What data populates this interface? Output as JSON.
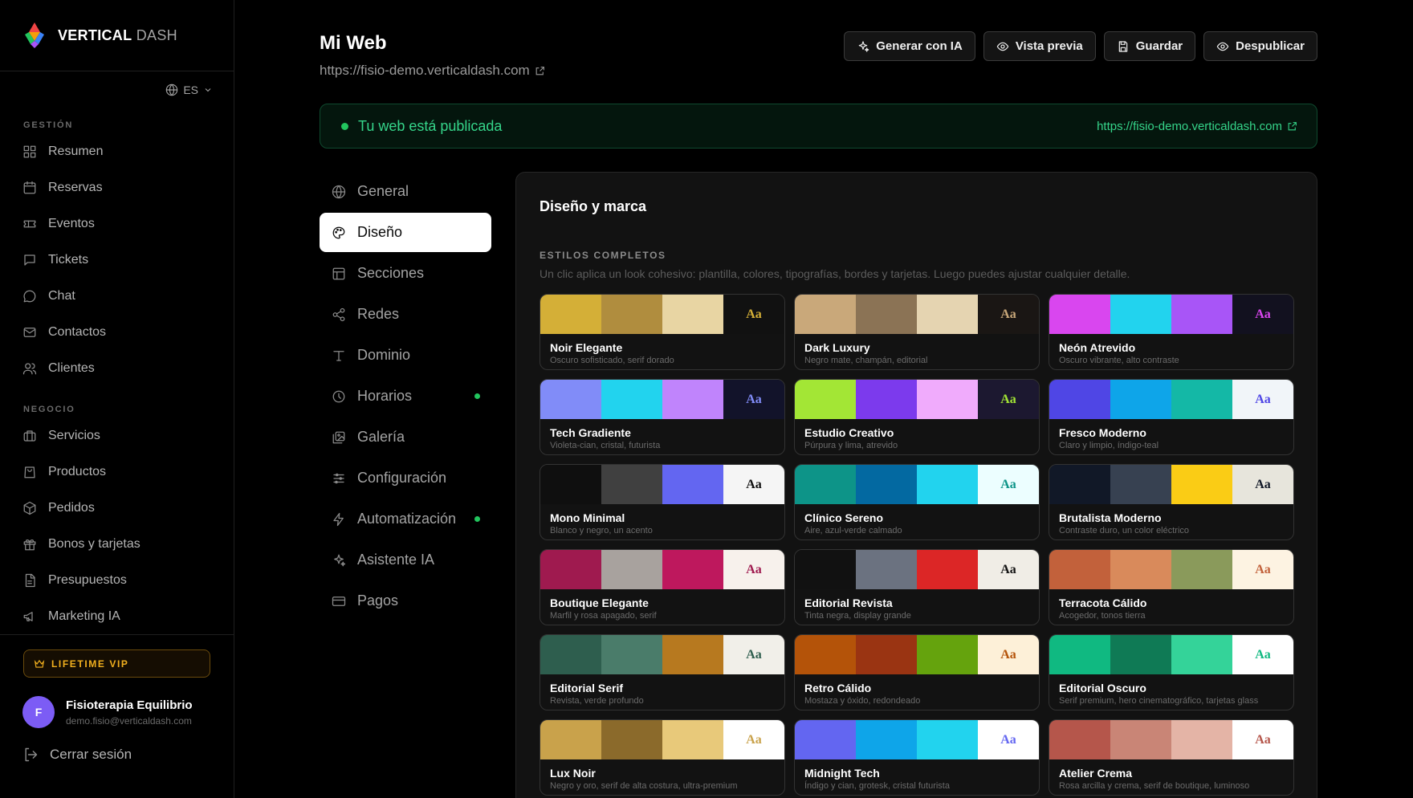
{
  "brand": {
    "name_bold": "VERTICAL",
    "name_light": "DASH"
  },
  "language": {
    "code": "ES"
  },
  "sidebar": {
    "sections": [
      {
        "label": "GESTIÓN",
        "items": [
          {
            "label": "Resumen",
            "icon": "grid-icon"
          },
          {
            "label": "Reservas",
            "icon": "calendar-icon"
          },
          {
            "label": "Eventos",
            "icon": "ticket-icon"
          },
          {
            "label": "Tickets",
            "icon": "message-square-icon"
          },
          {
            "label": "Chat",
            "icon": "chat-bubble-icon"
          },
          {
            "label": "Contactos",
            "icon": "mail-icon"
          },
          {
            "label": "Clientes",
            "icon": "users-icon"
          }
        ]
      },
      {
        "label": "NEGOCIO",
        "items": [
          {
            "label": "Servicios",
            "icon": "briefcase-icon"
          },
          {
            "label": "Productos",
            "icon": "shopping-bag-icon"
          },
          {
            "label": "Pedidos",
            "icon": "package-icon"
          },
          {
            "label": "Bonos y tarjetas",
            "icon": "gift-icon"
          },
          {
            "label": "Presupuestos",
            "icon": "file-text-icon"
          },
          {
            "label": "Marketing IA",
            "icon": "megaphone-icon"
          }
        ]
      }
    ],
    "vip_badge": "LIFETIME VIP",
    "user": {
      "initial": "F",
      "name": "Fisioterapia Equilibrio",
      "email": "demo.fisio@verticaldash.com"
    },
    "logout": "Cerrar sesión"
  },
  "header": {
    "title": "Mi Web",
    "url": "https://fisio-demo.verticaldash.com",
    "actions": [
      {
        "label": "Generar con IA",
        "icon": "sparkles-icon"
      },
      {
        "label": "Vista previa",
        "icon": "eye-icon"
      },
      {
        "label": "Guardar",
        "icon": "save-icon"
      },
      {
        "label": "Despublicar",
        "icon": "eye-icon"
      }
    ]
  },
  "status": {
    "text": "Tu web está publicada",
    "link": "https://fisio-demo.verticaldash.com",
    "color": "#35d58a"
  },
  "settings_nav": [
    {
      "label": "General",
      "icon": "globe-icon",
      "active": false,
      "dot": false
    },
    {
      "label": "Diseño",
      "icon": "palette-icon",
      "active": true,
      "dot": false
    },
    {
      "label": "Secciones",
      "icon": "layout-icon",
      "active": false,
      "dot": false
    },
    {
      "label": "Redes",
      "icon": "share-icon",
      "active": false,
      "dot": false
    },
    {
      "label": "Dominio",
      "icon": "type-icon",
      "active": false,
      "dot": false
    },
    {
      "label": "Horarios",
      "icon": "clock-icon",
      "active": false,
      "dot": true
    },
    {
      "label": "Galería",
      "icon": "images-icon",
      "active": false,
      "dot": false
    },
    {
      "label": "Configuración",
      "icon": "sliders-icon",
      "active": false,
      "dot": false
    },
    {
      "label": "Automatización",
      "icon": "zap-icon",
      "active": false,
      "dot": true
    },
    {
      "label": "Asistente IA",
      "icon": "sparkles-icon",
      "active": false,
      "dot": false
    },
    {
      "label": "Pagos",
      "icon": "credit-card-icon",
      "active": false,
      "dot": false
    }
  ],
  "design": {
    "title": "Diseño y marca",
    "section_label": "ESTILOS COMPLETOS",
    "section_desc": "Un clic aplica un look cohesivo: plantilla, colores, tipografías, bordes y tarjetas. Luego puedes ajustar cualquier detalle.",
    "preview_text": "Aa",
    "styles": [
      {
        "name": "Noir Elegante",
        "desc": "Oscuro sofisticado, serif dorado",
        "colors": [
          "#d4af37",
          "#b08d3e",
          "#e8d5a3",
          "#111111"
        ],
        "aa_color": "#d4af37"
      },
      {
        "name": "Dark Luxury",
        "desc": "Negro mate, champán, editorial",
        "colors": [
          "#c9a87a",
          "#8b7355",
          "#e5d4b1",
          "#1a1614"
        ],
        "aa_color": "#c9a87a"
      },
      {
        "name": "Neón Atrevido",
        "desc": "Oscuro vibrante, alto contraste",
        "colors": [
          "#d946ef",
          "#22d3ee",
          "#a855f7",
          "#12111f"
        ],
        "aa_color": "#d946ef"
      },
      {
        "name": "Tech Gradiente",
        "desc": "Violeta-cian, cristal, futurista",
        "colors": [
          "#818cf8",
          "#22d3ee",
          "#c084fc",
          "#12132a"
        ],
        "aa_color": "#818cf8"
      },
      {
        "name": "Estudio Creativo",
        "desc": "Púrpura y lima, atrevido",
        "colors": [
          "#a3e635",
          "#7c3aed",
          "#f0abfc",
          "#1c1830"
        ],
        "aa_color": "#a3e635"
      },
      {
        "name": "Fresco Moderno",
        "desc": "Claro y limpio, índigo-teal",
        "colors": [
          "#4f46e5",
          "#0ea5e9",
          "#14b8a6",
          "#f1f5f9"
        ],
        "aa_color": "#4f46e5"
      },
      {
        "name": "Mono Minimal",
        "desc": "Blanco y negro, un acento",
        "colors": [
          "#0f0f0f",
          "#404040",
          "#6366f1",
          "#f5f5f5"
        ],
        "aa_color": "#0f0f0f"
      },
      {
        "name": "Clínico Sereno",
        "desc": "Aire, azul-verde calmado",
        "colors": [
          "#0d9488",
          "#0369a1",
          "#22d3ee",
          "#ecfeff"
        ],
        "aa_color": "#0d9488"
      },
      {
        "name": "Brutalista Moderno",
        "desc": "Contraste duro, un color eléctrico",
        "colors": [
          "#111827",
          "#374151",
          "#facc15",
          "#e7e5dc"
        ],
        "aa_color": "#111827"
      },
      {
        "name": "Boutique Elegante",
        "desc": "Marfil y rosa apagado, serif",
        "colors": [
          "#9f1a4f",
          "#a8a29e",
          "#be185d",
          "#f7f1ec"
        ],
        "aa_color": "#9f1a4f"
      },
      {
        "name": "Editorial Revista",
        "desc": "Tinta negra, display grande",
        "colors": [
          "#111111",
          "#6b7280",
          "#dc2626",
          "#f0ede6"
        ],
        "aa_color": "#111111"
      },
      {
        "name": "Terracota Cálido",
        "desc": "Acogedor, tonos tierra",
        "colors": [
          "#c2613b",
          "#d98a5b",
          "#8a9a5b",
          "#fdf3e2"
        ],
        "aa_color": "#c2613b"
      },
      {
        "name": "Editorial Serif",
        "desc": "Revista, verde profundo",
        "colors": [
          "#2e5e4e",
          "#4a7c6a",
          "#b7791f",
          "#f1efe9"
        ],
        "aa_color": "#2e5e4e"
      },
      {
        "name": "Retro Cálido",
        "desc": "Mostaza y óxido, redondeado",
        "colors": [
          "#b45309",
          "#9a3412",
          "#65a30d",
          "#fdf0d8"
        ],
        "aa_color": "#b45309"
      },
      {
        "name": "Editorial Oscuro",
        "desc": "Serif premium, hero cinematográfico, tarjetas glass",
        "colors": [
          "#10b981",
          "#0f7a55",
          "#34d399",
          "#ffffff"
        ],
        "aa_color": "#10b981"
      },
      {
        "name": "Lux Noir",
        "desc": "Negro y oro, serif de alta costura, ultra-premium",
        "colors": [
          "#c9a24b",
          "#8b6a2b",
          "#e8c97a",
          "#ffffff"
        ],
        "aa_color": "#c9a24b"
      },
      {
        "name": "Midnight Tech",
        "desc": "Índigo y cian, grotesk, cristal futurista",
        "colors": [
          "#6366f1",
          "#0ea5e9",
          "#22d3ee",
          "#ffffff"
        ],
        "aa_color": "#6366f1"
      },
      {
        "name": "Atelier Crema",
        "desc": "Rosa arcilla y crema, serif de boutique, luminoso",
        "colors": [
          "#b5564b",
          "#c98576",
          "#e4b4a6",
          "#ffffff"
        ],
        "aa_color": "#b5564b"
      }
    ]
  },
  "accent_colors": {
    "vip": "#f2b01e",
    "success": "#22c55e",
    "avatar": "#7c5cf5"
  }
}
